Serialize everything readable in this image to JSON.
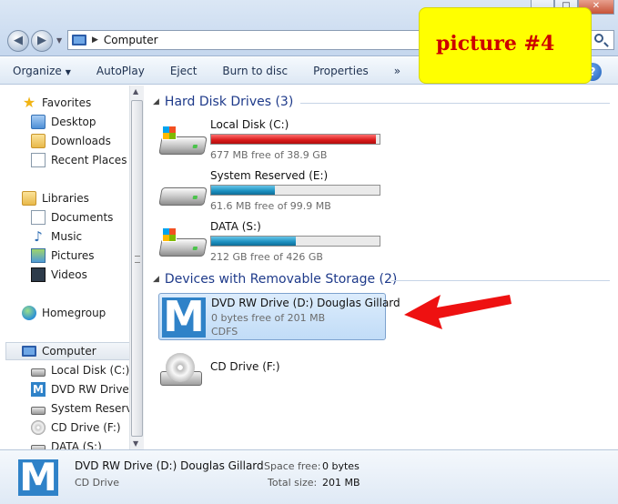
{
  "window": {
    "controls": {
      "minimize": "▁",
      "maximize": "□",
      "close": "✕"
    }
  },
  "address": {
    "back": "◀",
    "forward": "▶",
    "separator": "▶",
    "location": "Computer"
  },
  "note_label": "picture #4",
  "toolbar": {
    "items": [
      "Organize",
      "AutoPlay",
      "Eject",
      "Burn to disc",
      "Properties",
      "»"
    ],
    "organize_caret": "▼",
    "help": "?"
  },
  "nav": {
    "favorites": "Favorites",
    "desktop": "Desktop",
    "downloads": "Downloads",
    "recent": "Recent Places",
    "libraries": "Libraries",
    "documents": "Documents",
    "music": "Music",
    "pictures": "Pictures",
    "videos": "Videos",
    "homegroup": "Homegroup",
    "computer": "Computer",
    "local_disk": "Local Disk (C:)",
    "dvd_drive": "DVD RW Drive (D",
    "system_reserved": "System Reserved",
    "cd_drive": "CD Drive (F:)",
    "data": "DATA  (S:)"
  },
  "content": {
    "hdd_group": "Hard Disk Drives (3)",
    "removable_group": "Devices with Removable Storage (2)",
    "drives": [
      {
        "name": "Local Disk (C:)",
        "free": "677 MB free of 38.9 GB",
        "used_fraction": 0.98,
        "color": "#d81919"
      },
      {
        "name": "System Reserved (E:)",
        "free": "61.6 MB free of 99.9 MB",
        "used_fraction": 0.38,
        "color": "#1b8fbf"
      },
      {
        "name": "DATA  (S:)",
        "free": "212 GB free of 426 GB",
        "used_fraction": 0.5,
        "color": "#1b8fbf"
      }
    ],
    "dvd": {
      "name": "DVD RW Drive (D:) Douglas Gillard",
      "free": "0 bytes free of 201 MB",
      "fs": "CDFS"
    },
    "cd": {
      "name": "CD Drive (F:)"
    }
  },
  "details": {
    "name": "DVD RW Drive (D:) Douglas Gillard",
    "type": "CD Drive",
    "space_free_label": "Space free:",
    "space_free_value": "0 bytes",
    "total_size_label": "Total size:",
    "total_size_value": "201 MB"
  }
}
